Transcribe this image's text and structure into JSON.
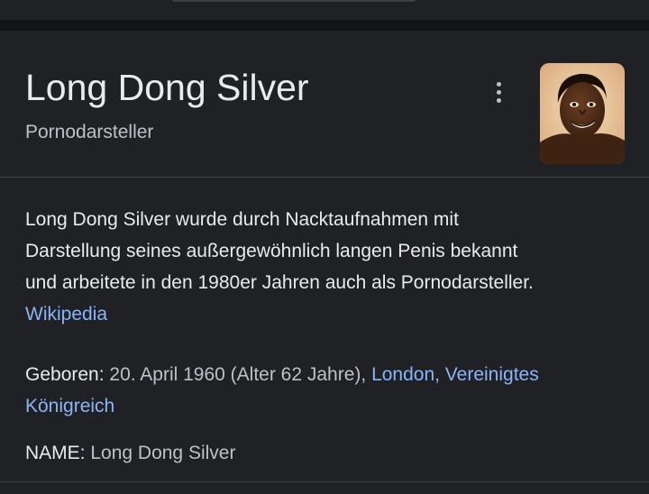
{
  "panel": {
    "title": "Long Dong Silver",
    "subtitle": "Pornodarsteller",
    "more_icon": "more-vert-icon",
    "image_alt": "portrait-photo"
  },
  "description": {
    "lines": [
      "Long Dong Silver wurde durch Nacktaufnahmen mit",
      "Darstellung seines außergewöhnlich langen Penis bekannt",
      "und arbeitete in den 1980er Jahren auch als Pornodarsteller."
    ],
    "source_link": "Wikipedia"
  },
  "facts": {
    "born": {
      "label": "Geboren:",
      "value": " 20. April 1960 (Alter 62 Jahre), ",
      "place_link_line1": "London, Vereinigtes",
      "place_link_line2": "Königreich"
    },
    "name": {
      "label": "NAME:",
      "value": " Long Dong Silver"
    }
  },
  "colors": {
    "background": "#202124",
    "text_primary": "#e8eaed",
    "text_secondary": "#bdc1c6",
    "link": "#8ab4f8",
    "divider": "#3c4043"
  }
}
